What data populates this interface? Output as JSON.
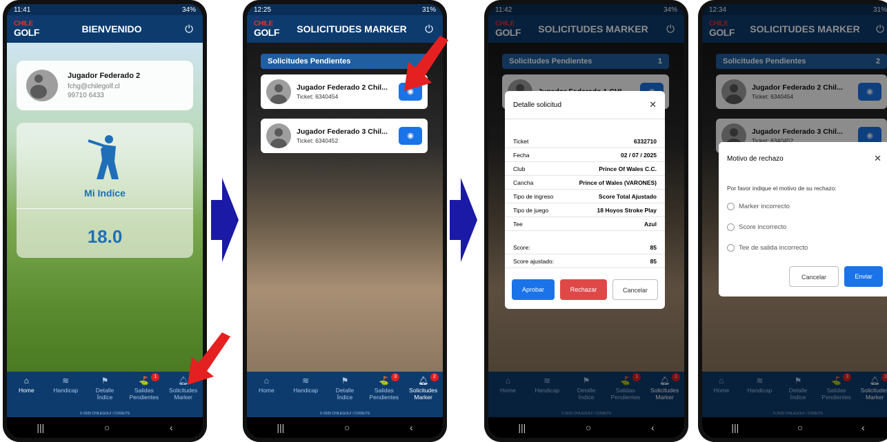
{
  "phones": [
    {
      "time": "11:41",
      "status_right": "34%",
      "title": "BIENVENIDO"
    },
    {
      "time": "12:25",
      "status_right": "31%",
      "title": "SOLICITUDES MARKER"
    },
    {
      "time": "11:42",
      "status_right": "34%",
      "title": "SOLICITUDES MARKER"
    },
    {
      "time": "12:34",
      "status_right": "31%",
      "title": "SOLICITUDES MARKER"
    }
  ],
  "logo": {
    "line1": "CHILE",
    "line2": "GOLF"
  },
  "nav": {
    "home": "Home",
    "handicap": "Handicap",
    "detalle_1": "Detalle",
    "detalle_2": "Índice",
    "salidas_1": "Salidas",
    "salidas_2": "Pendientes",
    "solicitudes_1": "Solicitudes",
    "solicitudes_2": "Marker"
  },
  "badges": {
    "p1_salidas": "1",
    "p2_salidas": "3",
    "p2_solicitudes": "2",
    "p3_salidas": "1",
    "p3_solicitudes": "1",
    "p4_salidas": "3",
    "p4_solicitudes": "2"
  },
  "footer": "© 2025 CHILEGOLF / CODEITS",
  "profile": {
    "name": "Jugador Federado 2",
    "email": "fchg@chilegolf.cl",
    "phone": "99710 6433"
  },
  "indice": {
    "label": "Mi Indice",
    "value": "18.0"
  },
  "pending": {
    "header": "Solicitudes Pendientes",
    "count_p3": "1",
    "count_p4": "2"
  },
  "requests": [
    {
      "name": "Jugador Federado 2 Chil...",
      "ticket": "Ticket: 6340454"
    },
    {
      "name": "Jugador Federado 3 Chil...",
      "ticket": "Ticket: 6340452"
    },
    {
      "name": "Jugador Federado 1 CHI...",
      "ticket": ""
    },
    {
      "name": "Jugador Federado 3 Chil...",
      "ticket": "Ticket: 6340452"
    }
  ],
  "detalle": {
    "title": "Detalle solicitud",
    "rows": [
      {
        "k": "Ticket",
        "v": "6332710"
      },
      {
        "k": "Fecha",
        "v": "02 / 07 / 2025"
      },
      {
        "k": "Club",
        "v": "Prince Of Wales C.C."
      },
      {
        "k": "Cancha",
        "v": "Prince of Wales (VARONES)"
      },
      {
        "k": "Tipo de ingreso",
        "v": "Score Total Ajustado"
      },
      {
        "k": "Tipo de juego",
        "v": "18 Hoyos Stroke Play"
      },
      {
        "k": "Tee",
        "v": "Azul"
      }
    ],
    "score_label": "Score:",
    "score": "85",
    "score_aj_label": "Score ajustado:",
    "score_aj": "85",
    "aprobar": "Aprobar",
    "rechazar": "Rechazar",
    "cancelar": "Cancelar"
  },
  "rechazo": {
    "title": "Motivo de rechazo",
    "prompt": "Por favor indique el motivo de su rechazo:",
    "options": [
      "Marker incorrecto",
      "Score incorrecto",
      "Tee de salida incorrecto"
    ],
    "cancelar": "Cancelar",
    "enviar": "Enviar"
  },
  "colors": {
    "appbar": "#0d3b6e",
    "primary": "#1a73e8",
    "danger": "#e04848",
    "arrow_blue": "#1a1aa6",
    "arrow_red": "#e52020"
  }
}
